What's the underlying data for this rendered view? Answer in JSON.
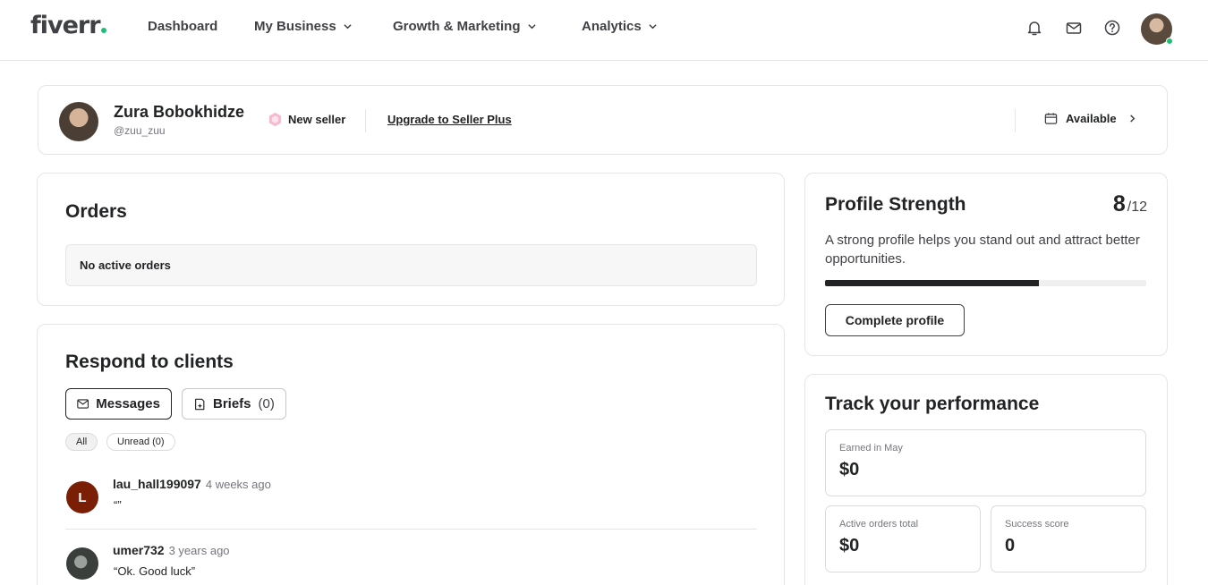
{
  "brand": {
    "logo_text": "fiverr",
    "accent_color": "#1dbf73"
  },
  "nav": {
    "items": [
      {
        "label": "Dashboard",
        "has_dropdown": false
      },
      {
        "label": "My Business",
        "has_dropdown": true
      },
      {
        "label": "Growth & Marketing",
        "has_dropdown": true
      },
      {
        "label": "Analytics",
        "has_dropdown": true
      }
    ],
    "icons": [
      "bell-icon",
      "envelope-icon",
      "help-icon"
    ]
  },
  "seller": {
    "name": "Zura Bobokhidze",
    "handle": "@zuu_zuu",
    "level": "New seller",
    "upgrade_link": "Upgrade to Seller Plus",
    "availability": "Available"
  },
  "orders": {
    "title": "Orders",
    "empty_message": "No active orders"
  },
  "respond": {
    "title": "Respond to clients",
    "tabs": [
      {
        "label": "Messages",
        "count": ""
      },
      {
        "label": "Briefs",
        "count": "(0)"
      }
    ],
    "filters": [
      "All",
      "Unread (0)"
    ],
    "messages": [
      {
        "avatar_letter": "L",
        "username": "lau_hall199097",
        "time": "4 weeks ago",
        "preview": "“”"
      },
      {
        "avatar_letter": "",
        "username": "umer732",
        "time": "3 years ago",
        "preview": "“Ok. Good luck”"
      }
    ]
  },
  "profile_strength": {
    "title": "Profile Strength",
    "score": "8",
    "max": "/12",
    "progress_fraction": 0.6667,
    "description": "A strong profile helps you stand out and attract better opportunities.",
    "button": "Complete profile"
  },
  "performance": {
    "title": "Track your performance",
    "earned_label": "Earned in May",
    "earned_value": "$0",
    "active_orders_label": "Active orders total",
    "active_orders_value": "$0",
    "success_label": "Success score",
    "success_value": "0"
  }
}
